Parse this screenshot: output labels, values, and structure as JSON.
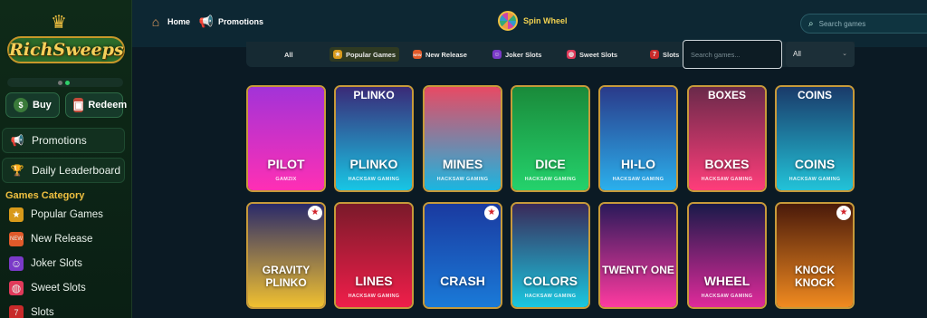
{
  "brand": {
    "logo_text": "RichSweeps"
  },
  "wallet": {
    "buy_label": "Buy",
    "redeem_label": "Redeem"
  },
  "sidebar": {
    "links": [
      {
        "label": "Promotions",
        "icon": "megaphone-icon"
      },
      {
        "label": "Daily Leaderboard",
        "icon": "trophy-icon"
      }
    ],
    "category_title": "Games Category",
    "categories": [
      {
        "label": "Popular Games",
        "icon": "shield-icon"
      },
      {
        "label": "New Release",
        "icon": "new-icon"
      },
      {
        "label": "Joker Slots",
        "icon": "joker-icon"
      },
      {
        "label": "Sweet Slots",
        "icon": "candy-icon"
      },
      {
        "label": "Slots",
        "icon": "slots-icon"
      }
    ]
  },
  "topbar": {
    "home_label": "Home",
    "promotions_label": "Promotions",
    "spin_label": "Spin Wheel",
    "search_placeholder": "Search games"
  },
  "filters": {
    "tabs": [
      "All",
      "Popular Games",
      "New Release",
      "Joker Slots",
      "Sweet Slots",
      "Slots"
    ],
    "active_tab": "Popular Games",
    "search_placeholder": "Search games...",
    "select_value": "All"
  },
  "games": [
    {
      "title": "PILOT",
      "provider": "GAMZIX",
      "colors": [
        "#a233d8",
        "#ff2fb4"
      ]
    },
    {
      "title": "PLINKO",
      "top": "PLINKO",
      "provider": "HACKSAW GAMING",
      "colors": [
        "#3a2a78",
        "#18c6e4"
      ]
    },
    {
      "title": "MINES",
      "provider": "HACKSAW GAMING",
      "colors": [
        "#e84a64",
        "#1bb6e0"
      ]
    },
    {
      "title": "DICE",
      "provider": "HACKSAW GAMING",
      "colors": [
        "#1a8a3a",
        "#24d26c"
      ]
    },
    {
      "title": "HI-LO",
      "provider": "HACKSAW GAMING",
      "colors": [
        "#2a3a8a",
        "#2bb0ec"
      ]
    },
    {
      "title": "BOXES",
      "top": "BOXES",
      "provider": "HACKSAW GAMING",
      "colors": [
        "#6a2a4a",
        "#ff3d7a"
      ]
    },
    {
      "title": "COINS",
      "top": "COINS",
      "provider": "HACKSAW GAMING",
      "colors": [
        "#1a3a6a",
        "#22c3d8"
      ]
    },
    {
      "title": "GRAVITY PLINKO",
      "provider": "",
      "colors": [
        "#2a2a6a",
        "#f0c030"
      ],
      "badge": true
    },
    {
      "title": "LINES",
      "provider": "HACKSAW GAMING",
      "colors": [
        "#7a1a2a",
        "#f01e4a"
      ]
    },
    {
      "title": "CRASH",
      "provider": "",
      "colors": [
        "#1a3aa0",
        "#1a7ad8"
      ],
      "badge": true
    },
    {
      "title": "COLORS",
      "provider": "HACKSAW GAMING",
      "colors": [
        "#3a2a5a",
        "#1ac8e0"
      ]
    },
    {
      "title": "TWENTY ONE",
      "provider": "",
      "colors": [
        "#2a1a5a",
        "#ff3aa0"
      ]
    },
    {
      "title": "WHEEL",
      "provider": "HACKSAW GAMING",
      "colors": [
        "#1a1a4a",
        "#e02a9a"
      ]
    },
    {
      "title": "KNOCK KNOCK",
      "provider": "",
      "colors": [
        "#4a1a0a",
        "#f08a20"
      ],
      "badge": true
    }
  ]
}
